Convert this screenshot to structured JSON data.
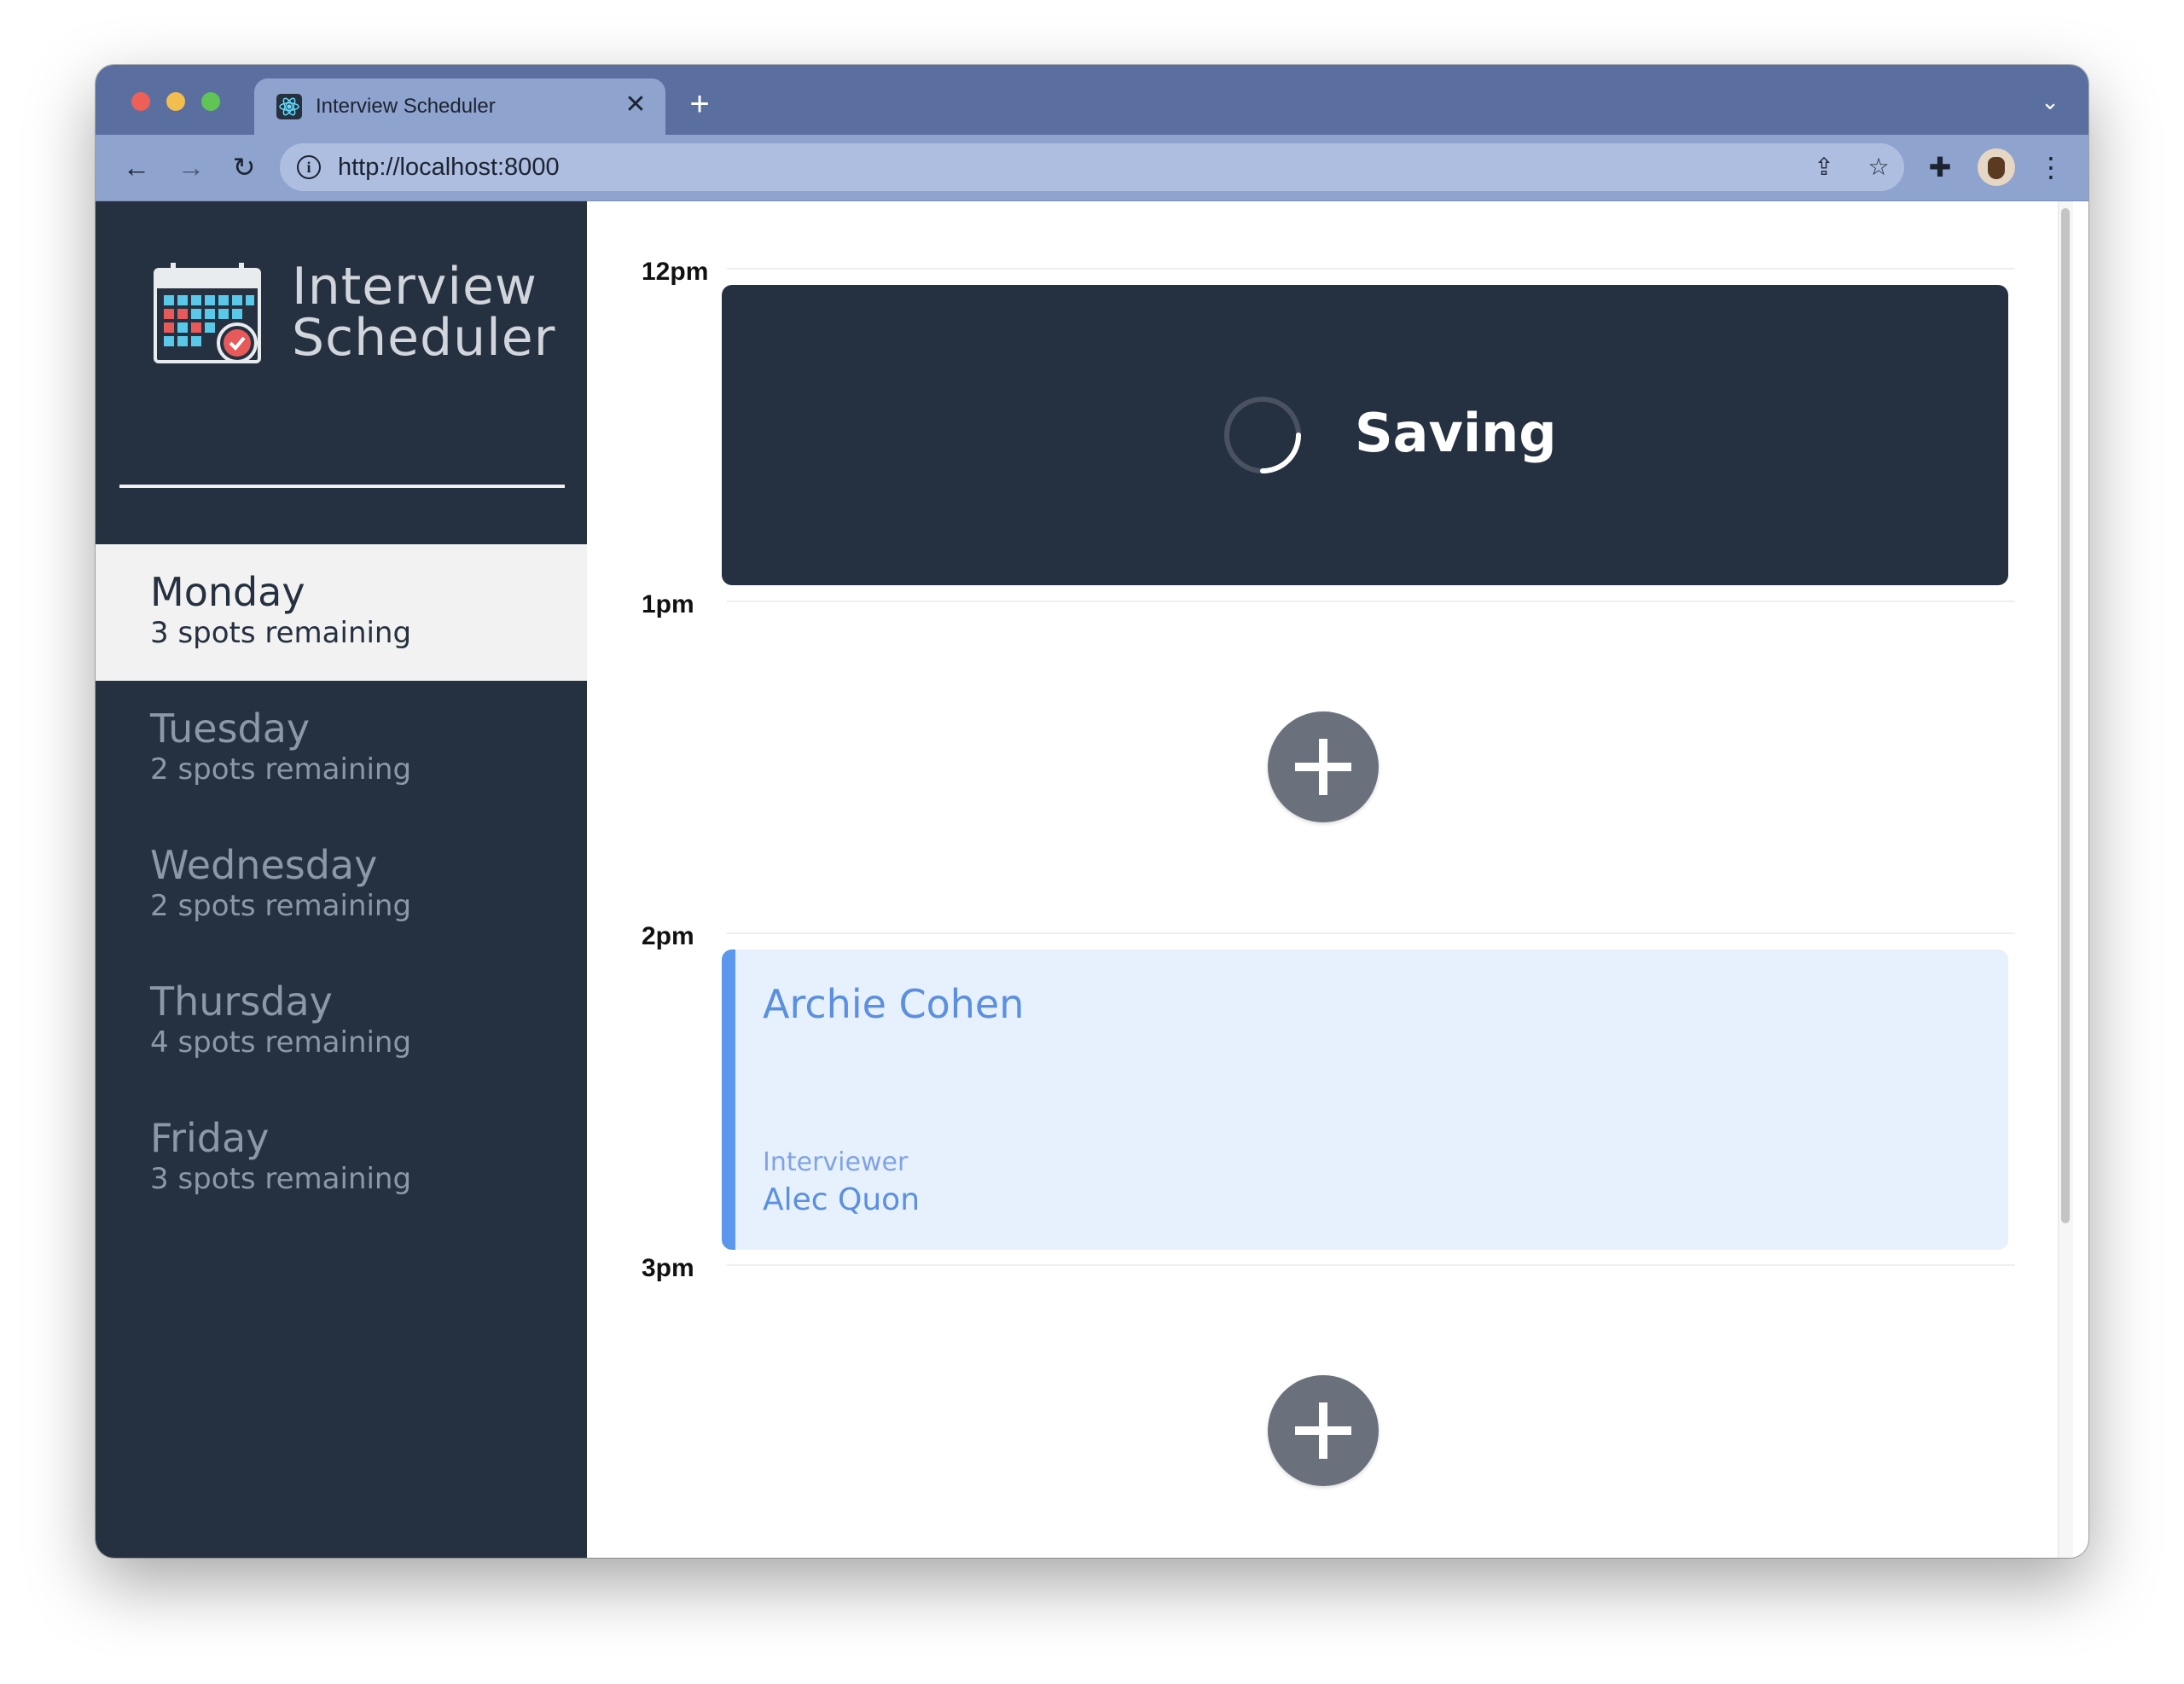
{
  "browser": {
    "tab_title": "Interview Scheduler",
    "tab_close_glyph": "✕",
    "new_tab_glyph": "+",
    "tab_menu_glyph": "⌄",
    "url": "http://localhost:8000",
    "back_glyph": "←",
    "forward_glyph": "→",
    "reload_glyph": "↻",
    "info_glyph": "i",
    "share_glyph": "⇪",
    "bookmark_glyph": "☆",
    "extensions_glyph": "✚",
    "menu_glyph": "⋮"
  },
  "sidebar": {
    "logo_line1": "Interview",
    "logo_line2": "Scheduler",
    "days": [
      {
        "name": "Monday",
        "spots": "3 spots remaining",
        "selected": true
      },
      {
        "name": "Tuesday",
        "spots": "2 spots remaining",
        "selected": false
      },
      {
        "name": "Wednesday",
        "spots": "2 spots remaining",
        "selected": false
      },
      {
        "name": "Thursday",
        "spots": "4 spots remaining",
        "selected": false
      },
      {
        "name": "Friday",
        "spots": "3 spots remaining",
        "selected": false
      }
    ]
  },
  "schedule": {
    "slots": [
      {
        "time": "12pm",
        "state": "saving",
        "status_text": "Saving"
      },
      {
        "time": "1pm",
        "state": "empty"
      },
      {
        "time": "2pm",
        "state": "booked",
        "student": "Archie Cohen",
        "interviewer_label": "Interviewer",
        "interviewer": "Alec Quon"
      },
      {
        "time": "3pm",
        "state": "empty"
      }
    ]
  },
  "colors": {
    "sidebar_bg": "#253040",
    "selected_day_bg": "#f2f2f2",
    "appointment_accent": "#5b97ec",
    "appointment_bg": "#e7f0fd",
    "add_button": "#6b717c",
    "browser_frame": "#5a6fa0"
  },
  "icons": {
    "logo": "calendar-check-icon",
    "add": "plus-icon",
    "saving": "spinner-icon"
  }
}
